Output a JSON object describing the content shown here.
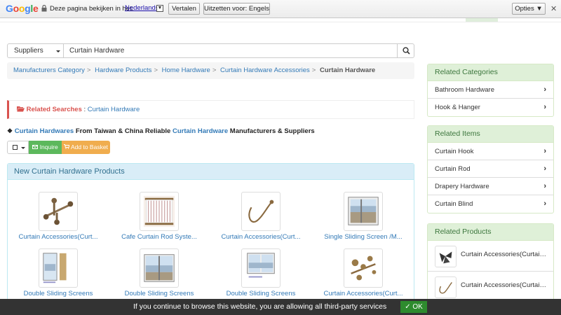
{
  "translate_bar": {
    "logo": [
      "G",
      "o",
      "o",
      "g",
      "l",
      "e"
    ],
    "question": "Deze pagina bekijken in het:",
    "language": "Nederlands",
    "translate_button": "Vertalen",
    "turn_off_button": "Uitzetten voor: Engels",
    "options_button": "Opties ▼",
    "close": "✕"
  },
  "search": {
    "category": "Suppliers",
    "query": "Curtain Hardware"
  },
  "breadcrumb": {
    "items": [
      "Manufacturers Category",
      "Hardware Products",
      "Home Hardware",
      "Curtain Hardware Accessories"
    ],
    "separator": ">",
    "current": "Curtain Hardware"
  },
  "related_searches": {
    "label": "Related Searches",
    "separator": ":",
    "term": "Curtain Hardware"
  },
  "headline": {
    "part1": "Curtain Hardwares",
    "part2": " From Taiwan & China Reliable ",
    "part3": "Curtain Hardware",
    "part4": " Manufacturers & Suppliers"
  },
  "toolbar": {
    "inquire": "Inquire",
    "add_to_basket": "Add to Basket"
  },
  "products_panel": {
    "title": "New Curtain Hardware Products",
    "items": [
      {
        "name": "Curtain Accessories(Curt..."
      },
      {
        "name": "Cafe Curtain Rod Syste..."
      },
      {
        "name": "Curtain Accessories(Curt..."
      },
      {
        "name": "Single Sliding Screen /M..."
      },
      {
        "name": "Double Sliding Screens"
      },
      {
        "name": "Double Sliding Screens"
      },
      {
        "name": "Double Sliding Screens"
      },
      {
        "name": "Curtain Accessories(Curt..."
      }
    ]
  },
  "related_categories": {
    "title": "Related Categories",
    "items": [
      "Bathroom Hardware",
      "Hook & Hanger"
    ]
  },
  "related_items": {
    "title": "Related Items",
    "items": [
      "Curtain Hook",
      "Curtain Rod",
      "Drapery Hardware",
      "Curtain Blind"
    ]
  },
  "related_products": {
    "title": "Related Products",
    "items": [
      "Curtain Accessories(Curtain Hardware)",
      "Curtain Accessories(Curtain Hardware)"
    ]
  },
  "cookie_bar": {
    "message": "If you continue to browse this website, you are allowing all third-party services",
    "ok": "✓ OK"
  },
  "colors": {
    "link": "#337ab7",
    "danger": "#d9534f",
    "success": "#5cb85c",
    "warning": "#f0ad4e",
    "info_bg": "#d9edf7",
    "green_bg": "#dff0d8"
  }
}
